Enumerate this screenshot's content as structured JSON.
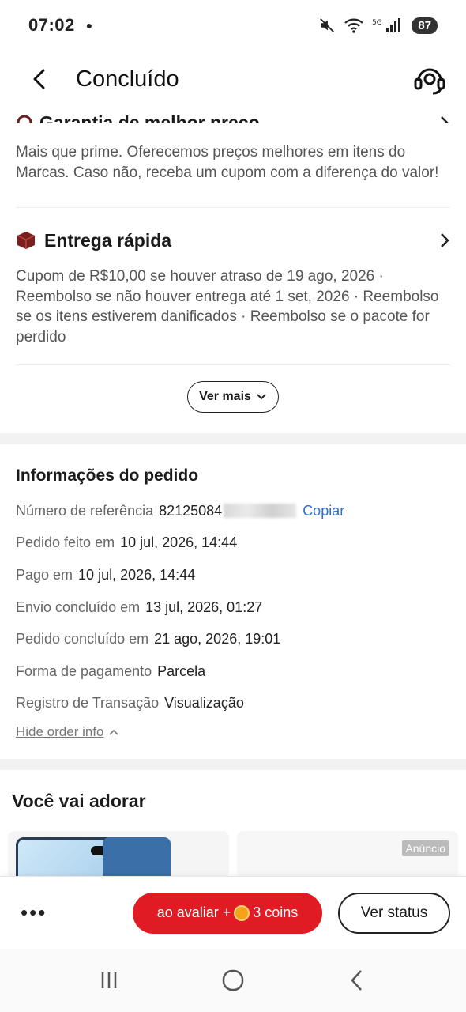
{
  "status_bar": {
    "time": "07:02",
    "battery": "87"
  },
  "header": {
    "title": "Concluído"
  },
  "guarantee": {
    "title": "Garantia de melhor preço",
    "description": "Mais que prime. Oferecemos preços melhores em itens do Marcas. Caso não, receba um cupom com a diferença do valor!"
  },
  "delivery": {
    "title": "Entrega rápida",
    "description": "Cupom de R$10,00 se houver atraso de 19 ago, 2026 · Reembolso se não houver entrega até 1 set, 2026 · Reembolso se os itens estiverem danificados · Reembolso se o pacote for perdido"
  },
  "ver_mais": "Ver mais",
  "order_info": {
    "title": "Informações do pedido",
    "rows": [
      {
        "label": "Número de referência",
        "value": "82125084"
      },
      {
        "label": "Pedido feito em",
        "value": "10 jul, 2026, 14:44"
      },
      {
        "label": "Pago em",
        "value": "10 jul, 2026, 14:44"
      },
      {
        "label": "Envio concluído em",
        "value": "13 jul, 2026, 01:27"
      },
      {
        "label": "Pedido concluído em",
        "value": "21 ago, 2026, 19:01"
      },
      {
        "label": "Forma de pagamento",
        "value": "Parcela"
      },
      {
        "label": "Registro de Transação",
        "value": "Visualização"
      }
    ],
    "copy_label": "Copiar",
    "hide_label": "Hide order info"
  },
  "recommendations": {
    "title": "Você vai adorar",
    "ad_badge": "Anúncio"
  },
  "action_bar": {
    "more": "•••",
    "review_prefix": "ao avaliar +",
    "review_suffix": "3 coins",
    "status": "Ver status"
  },
  "colors": {
    "accent": "#e01b24",
    "link": "#2b6fd6",
    "coin": "#f7a21b"
  }
}
